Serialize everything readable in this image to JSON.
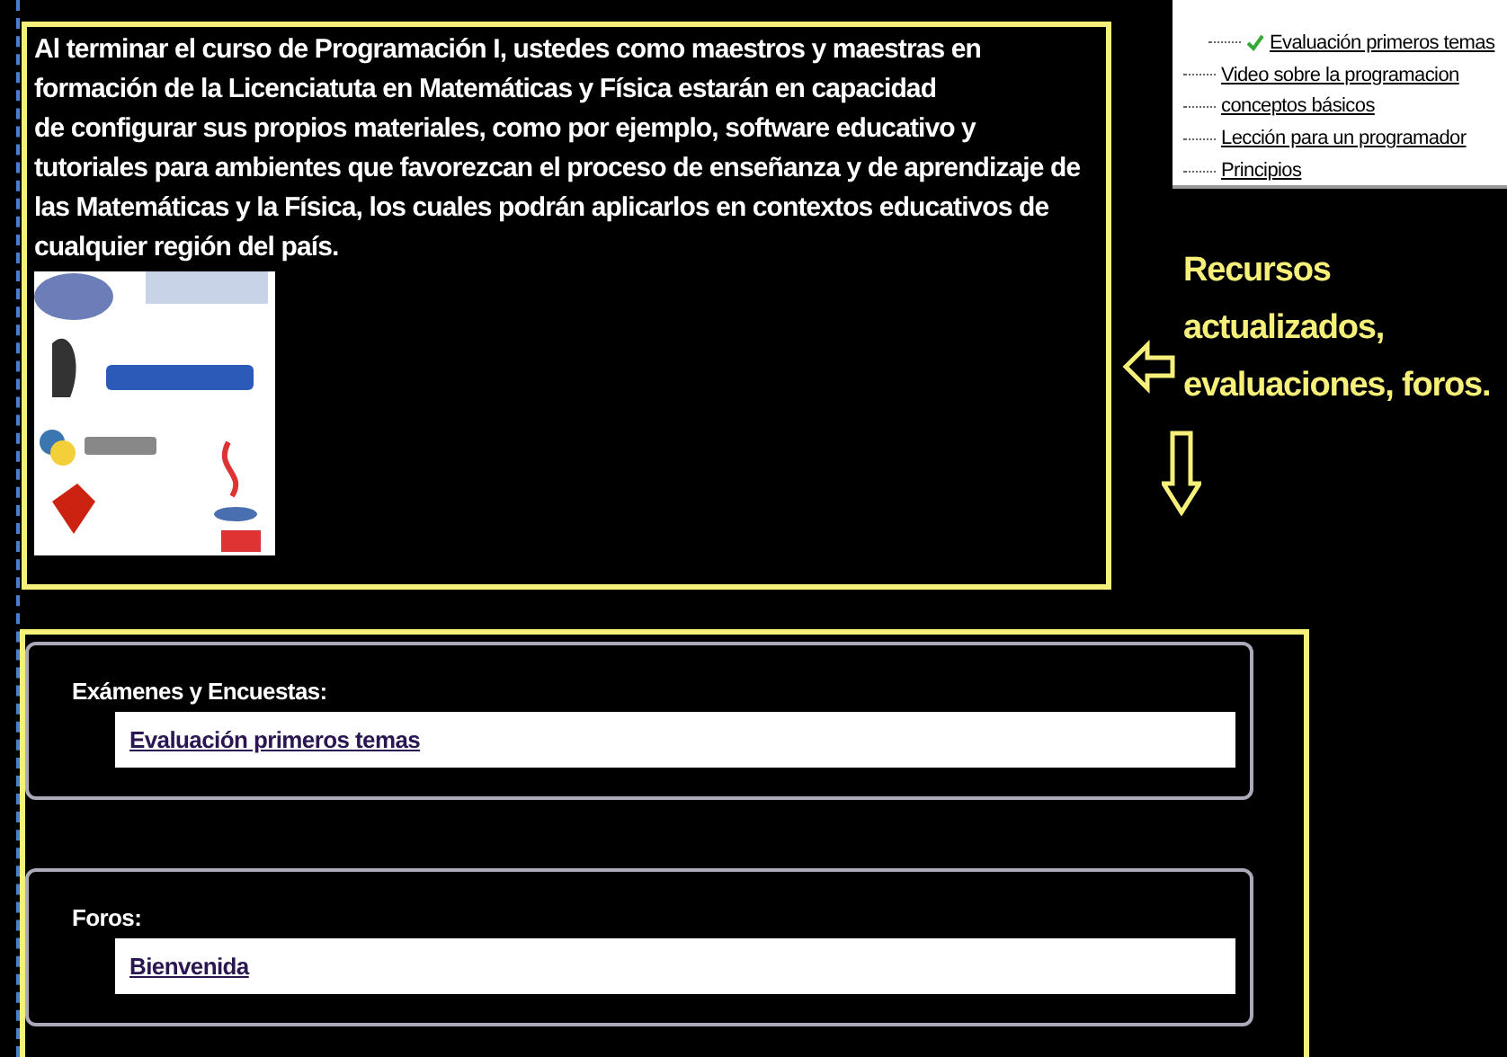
{
  "intro": {
    "text": "Al terminar el curso de Programación I, ustedes como maestros y maestras en\nformación de la Licenciatuta en Matemáticas y Física estarán en capacidad\nde configurar sus propios materiales, como por ejemplo, software educativo y\ntutoriales para ambientes que favorezcan el proceso de enseñanza y de aprendizaje de\nlas Matemáticas y la Física, los cuales podrán aplicarlos en contextos educativos de\ncualquier región del país."
  },
  "course_tree": {
    "items": [
      {
        "label": "Evaluación primeros temas",
        "kind": "sub",
        "checked": true
      },
      {
        "label": "Video sobre la programacion",
        "kind": "top",
        "checked": false
      },
      {
        "label": "conceptos básicos",
        "kind": "top",
        "checked": false
      },
      {
        "label": "Lección para un programador",
        "kind": "top",
        "checked": false
      },
      {
        "label": "Principios",
        "kind": "top",
        "checked": false
      }
    ]
  },
  "annotation": {
    "text": "Recursos\nactualizados,\nevaluaciones, foros."
  },
  "sections": [
    {
      "heading": "Exámenes y Encuestas:",
      "links": [
        "Evaluación primeros temas"
      ]
    },
    {
      "heading": "Foros:",
      "links": [
        "Bienvenida"
      ]
    }
  ]
}
